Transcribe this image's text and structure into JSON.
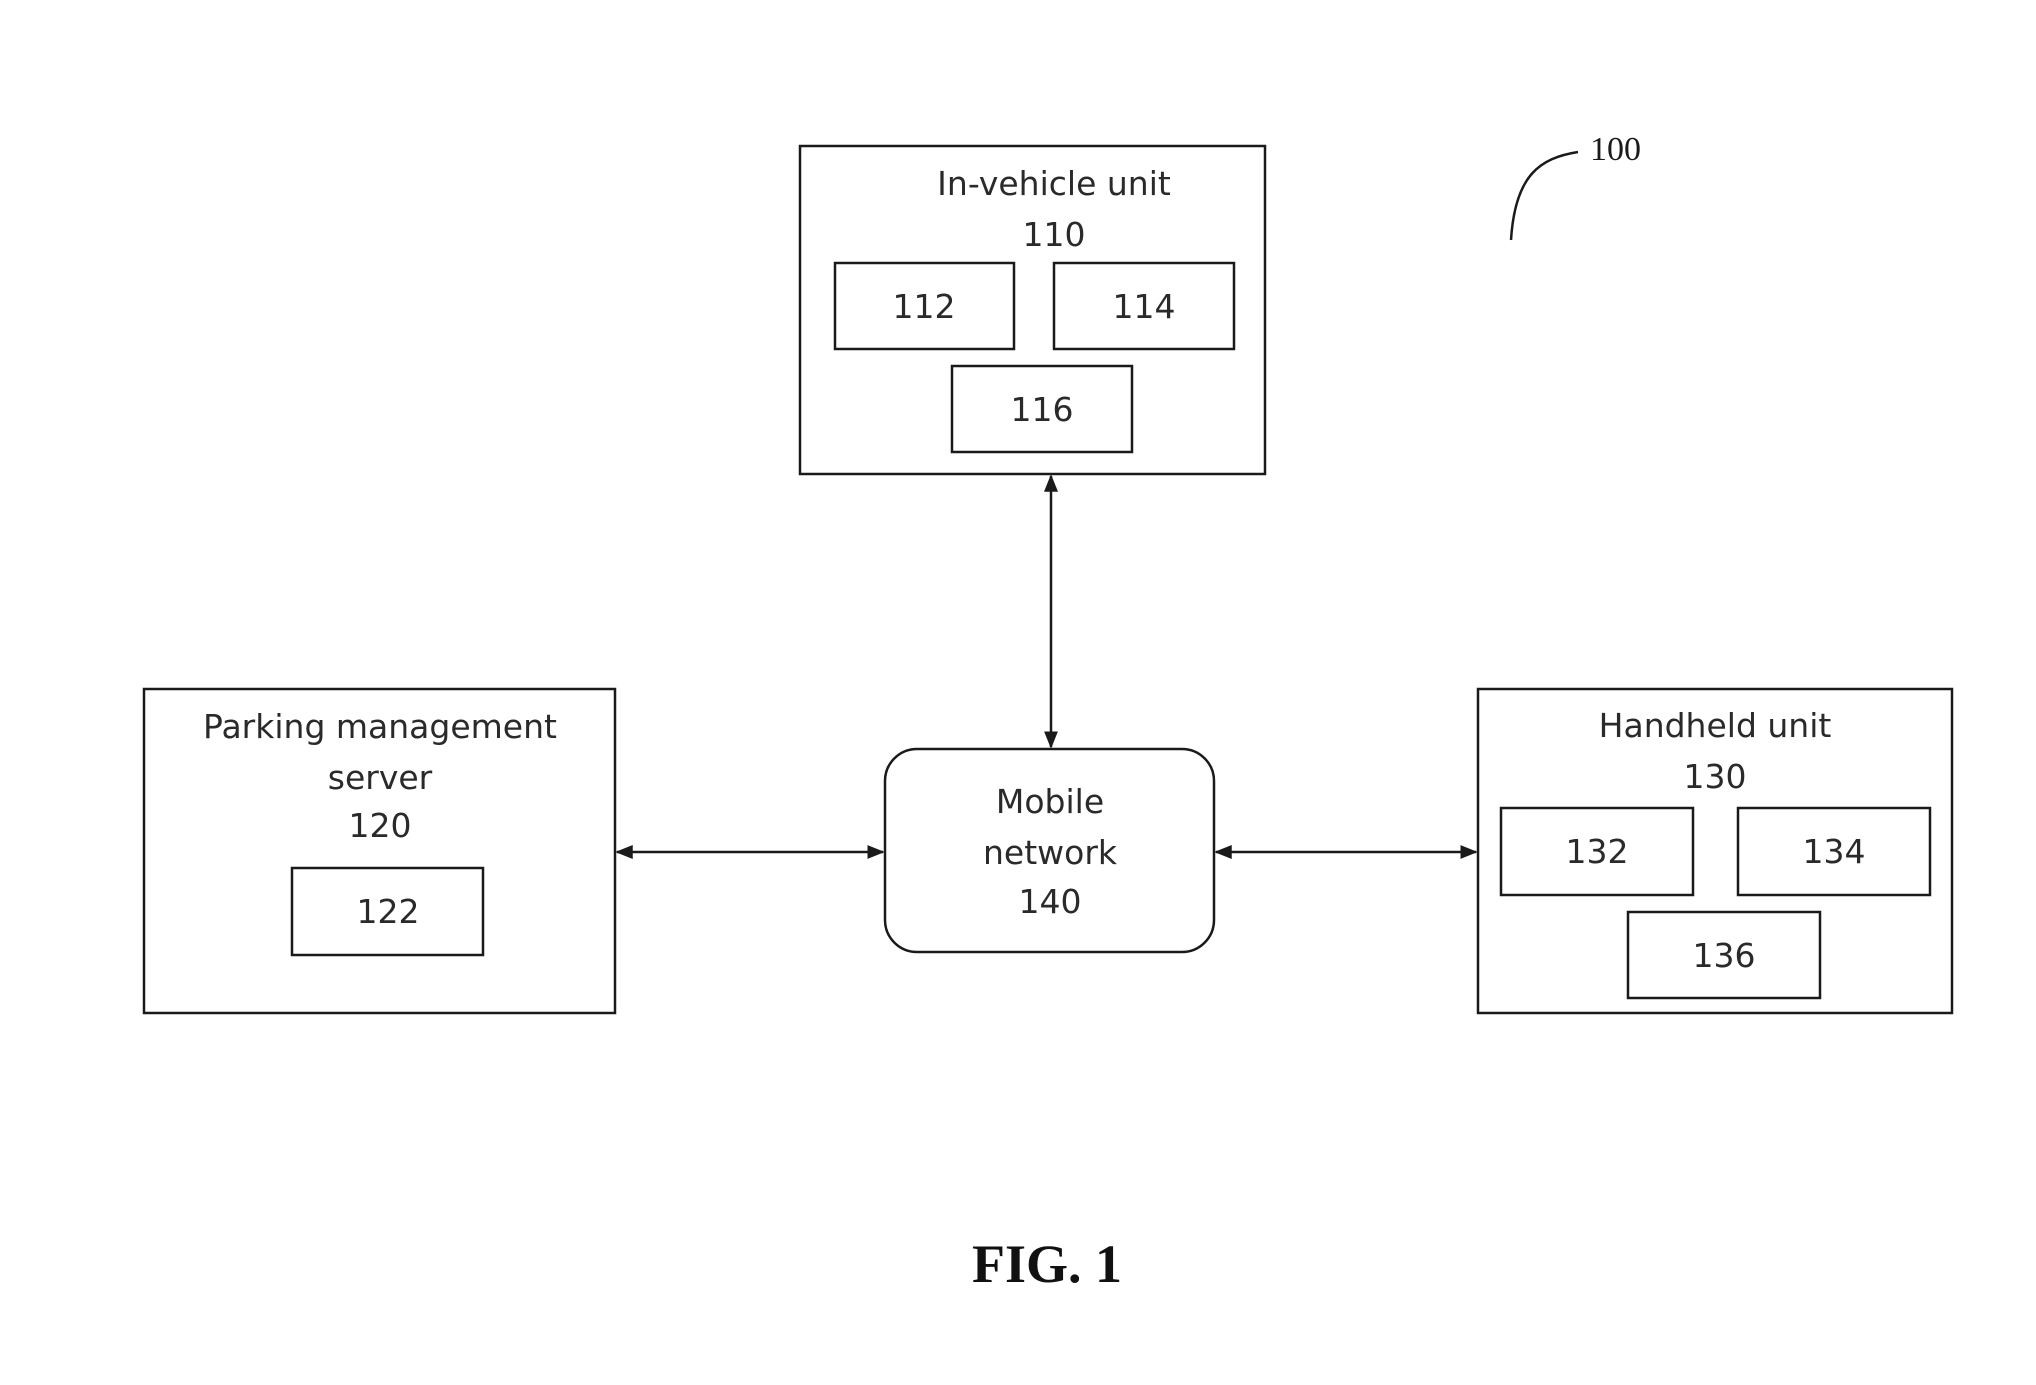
{
  "figure": {
    "caption": "FIG. 1",
    "reference_numeral": "100"
  },
  "in_vehicle_unit": {
    "title": "In-vehicle unit",
    "numeral": "110",
    "components": [
      "112",
      "114",
      "116"
    ]
  },
  "parking_server": {
    "title_line1": "Parking management",
    "title_line2": "server",
    "numeral": "120",
    "components": [
      "122"
    ]
  },
  "handheld_unit": {
    "title": "Handheld unit",
    "numeral": "130",
    "components": [
      "132",
      "134",
      "136"
    ]
  },
  "mobile_network": {
    "title_line1": "Mobile",
    "title_line2": "network",
    "numeral": "140"
  },
  "connections": [
    {
      "from": "in_vehicle_unit",
      "to": "mobile_network",
      "direction": "bidirectional"
    },
    {
      "from": "parking_server",
      "to": "mobile_network",
      "direction": "bidirectional"
    },
    {
      "from": "handheld_unit",
      "to": "mobile_network",
      "direction": "bidirectional"
    }
  ]
}
